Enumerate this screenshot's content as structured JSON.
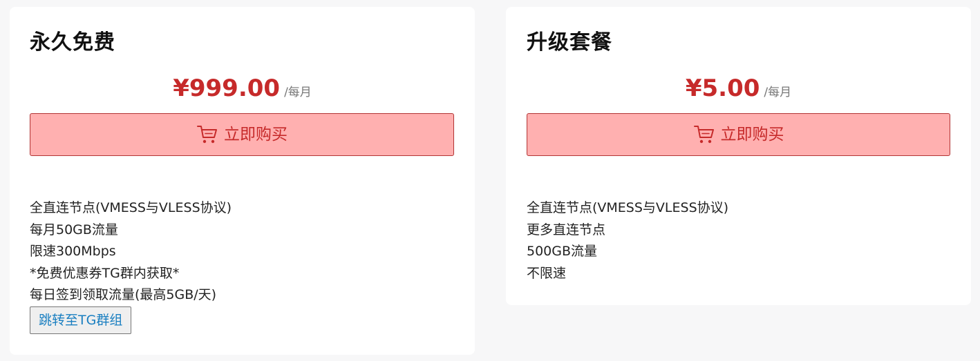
{
  "plans": [
    {
      "title": "永久免费",
      "price": "¥999.00",
      "period": "/每月",
      "buy_label": "立即购买",
      "features": [
        "全直连节点(VMESS与VLESS协议)",
        "每月50GB流量",
        "限速300Mbps",
        "*免费优惠券TG群内获取*",
        "每日签到领取流量(最高5GB/天)"
      ],
      "tg_button_label": "跳转至TG群组"
    },
    {
      "title": "升级套餐",
      "price": "¥5.00",
      "period": "/每月",
      "buy_label": "立即购买",
      "features": [
        "全直连节点(VMESS与VLESS协议)",
        "更多直连节点",
        "500GB流量",
        "不限速"
      ]
    }
  ],
  "icons": {
    "buy": "shopping-cart-icon"
  },
  "colors": {
    "price": "#c62a2a",
    "buy_button_bg": "#ffb0b0",
    "buy_button_border": "#b23333",
    "link": "#1a7fc1",
    "page_bg": "#f7f7f8",
    "card_bg": "#ffffff"
  }
}
